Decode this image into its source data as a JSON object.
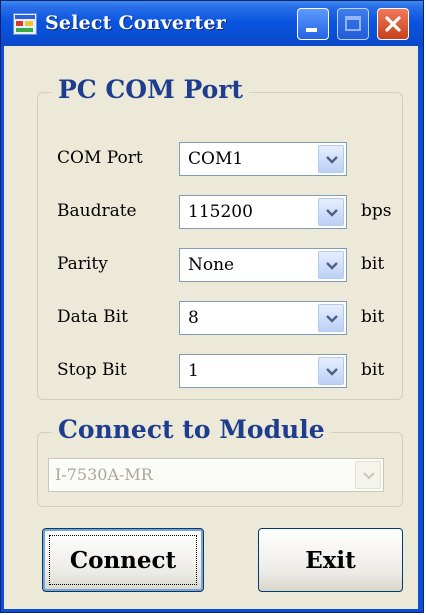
{
  "window": {
    "title": "Select Converter",
    "icons": {
      "app": "app-icon",
      "minimize": "minimize-icon",
      "maximize": "maximize-icon",
      "close": "close-icon"
    }
  },
  "pc_com_port": {
    "group_title": "PC COM Port",
    "rows": [
      {
        "label": "COM Port",
        "value": "COM1",
        "unit": ""
      },
      {
        "label": "Baudrate",
        "value": "115200",
        "unit": "bps"
      },
      {
        "label": "Parity",
        "value": "None",
        "unit": "bit"
      },
      {
        "label": "Data Bit",
        "value": "8",
        "unit": "bit"
      },
      {
        "label": "Stop Bit",
        "value": "1",
        "unit": "bit"
      }
    ]
  },
  "connect_to_module": {
    "group_title": "Connect to Module",
    "value": "I-7530A-MR",
    "enabled": false
  },
  "buttons": {
    "connect": "Connect",
    "exit": "Exit"
  },
  "colors": {
    "titlebar": "#0a55e0",
    "group_title": "#1e3d8f",
    "client_bg": "#ece9d8",
    "close_button": "#c7401b"
  }
}
